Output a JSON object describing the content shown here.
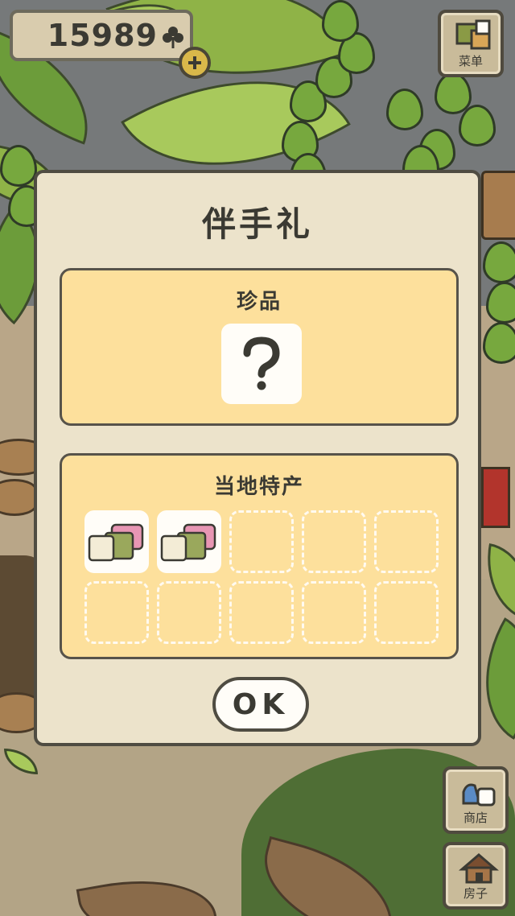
{
  "hud": {
    "coin_count": "15989",
    "menu_label": "菜单",
    "shop_label": "商店",
    "house_label": "房子"
  },
  "dialog": {
    "title": "伴手礼",
    "rare_section": {
      "title": "珍品"
    },
    "local_section": {
      "title": "当地特产",
      "slots": [
        {
          "state": "filled",
          "item_icon": "sakura-mochi-icon"
        },
        {
          "state": "filled",
          "item_icon": "sakura-mochi-icon"
        },
        {
          "state": "empty"
        },
        {
          "state": "empty"
        },
        {
          "state": "empty"
        },
        {
          "state": "empty"
        },
        {
          "state": "empty"
        },
        {
          "state": "empty"
        },
        {
          "state": "empty"
        },
        {
          "state": "empty"
        }
      ]
    },
    "ok_label": "OK"
  },
  "colors": {
    "dialog_bg": "#ece3cb",
    "panel_bg": "#fde09c",
    "outline": "#4f4c42",
    "text": "#3b3a33"
  }
}
